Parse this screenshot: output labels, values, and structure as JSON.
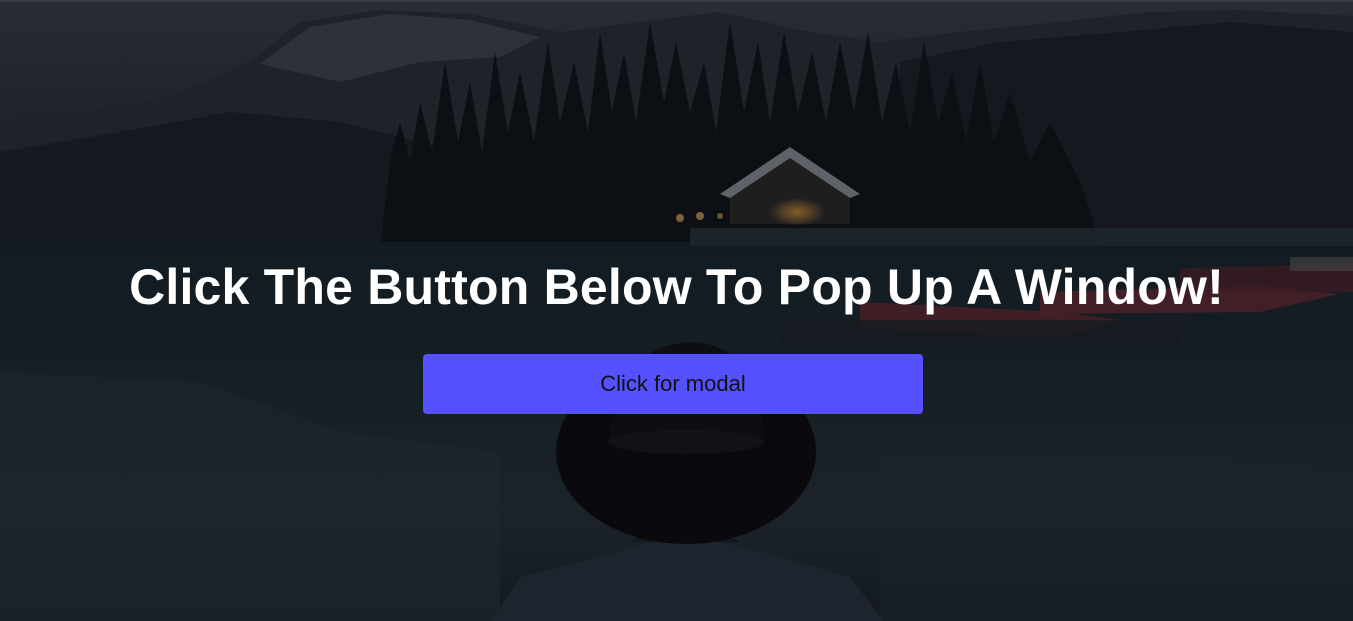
{
  "hero": {
    "heading": "Click The Button Below To Pop Up A Window!",
    "button_label": "Click for modal"
  },
  "colors": {
    "button_background": "#5551ff",
    "button_text": "#111111",
    "heading_text": "#ffffff"
  }
}
